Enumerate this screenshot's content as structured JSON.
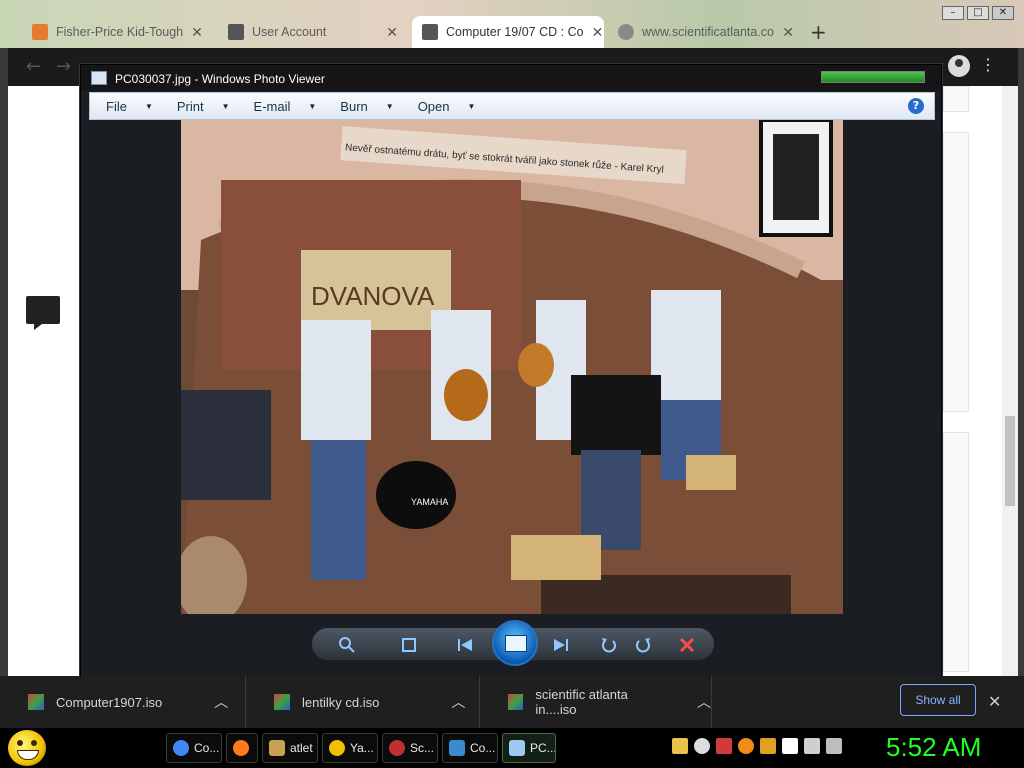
{
  "browser": {
    "tabs": [
      {
        "title": "Fisher-Price Kid-Tough",
        "color": "#e67a2e",
        "active": false
      },
      {
        "title": "User Account",
        "color": "#555555",
        "active": false
      },
      {
        "title": "Computer 19/07 CD : Co",
        "color": "#555555",
        "active": true
      },
      {
        "title": "www.scientificatlanta.co",
        "color": "#8a8a8a",
        "active": false
      }
    ],
    "new_tab": "+"
  },
  "photo_viewer": {
    "title": "PC030037.jpg - Windows Photo Viewer",
    "menu": [
      {
        "label": "File"
      },
      {
        "label": "Print"
      },
      {
        "label": "E-mail"
      },
      {
        "label": "Burn"
      },
      {
        "label": "Open"
      }
    ],
    "help": "?",
    "photo_caption": "Nevěř ostnatému drátu, byť se stokrát tvářil jako stonek růže - Karel Kryl",
    "photo_sign": "DVANOVA",
    "drum_label": "YAMAHA"
  },
  "downloads": {
    "items": [
      {
        "name": "Computer1907.iso"
      },
      {
        "name": "lentilky cd.iso"
      },
      {
        "name": "scientific atlanta in....iso"
      }
    ],
    "show_all": "Show all",
    "close": "✕"
  },
  "taskbar": {
    "items": [
      {
        "label": "Co...",
        "color": "#4285f4"
      },
      {
        "label": "",
        "color": "#ff7a1a"
      },
      {
        "label": "atlet",
        "color": "#c8a050"
      },
      {
        "label": "Ya...",
        "color": "#f0c000"
      },
      {
        "label": "Sc...",
        "color": "#c03030"
      },
      {
        "label": "Co...",
        "color": "#3a8ad0"
      },
      {
        "label": "PC...",
        "color": "#9ec9f0"
      }
    ],
    "clock": "5:52 AM"
  }
}
